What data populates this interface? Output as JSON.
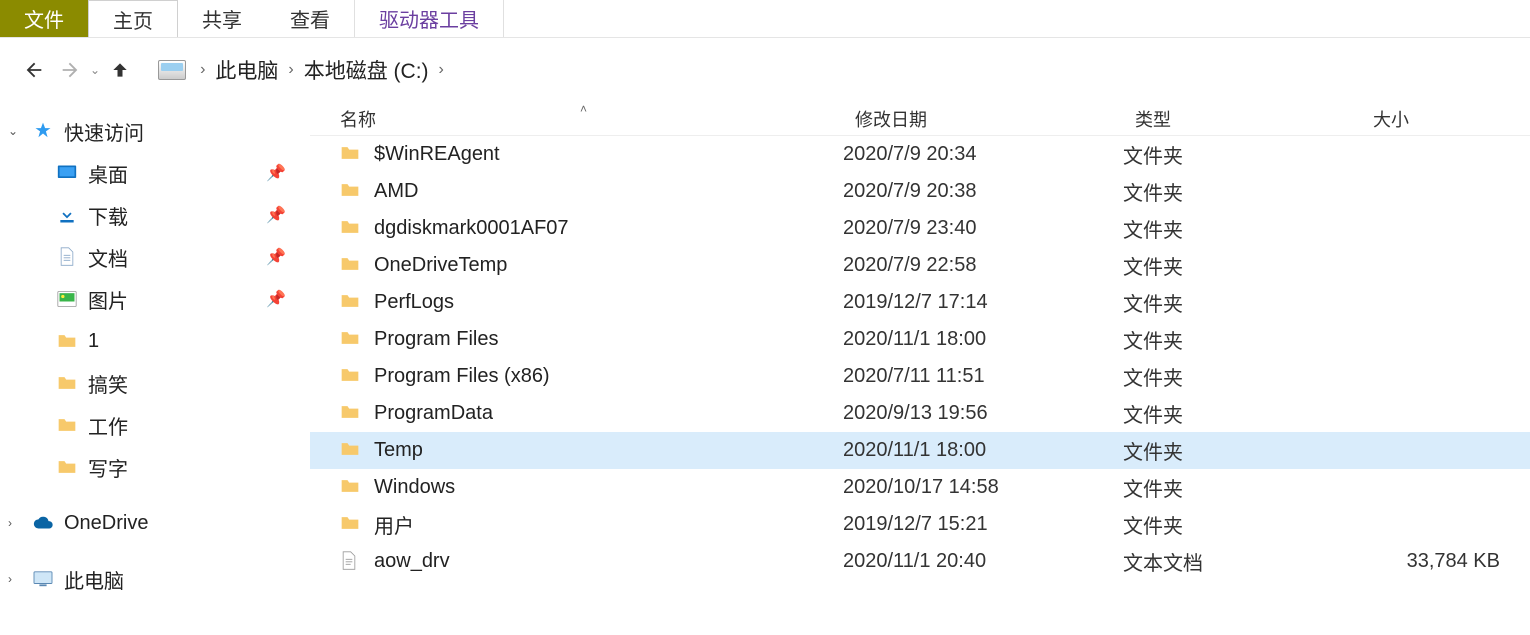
{
  "ribbon": {
    "tabs": {
      "file": "文件",
      "home": "主页",
      "share": "共享",
      "view": "查看",
      "drive_tools": "驱动器工具"
    }
  },
  "breadcrumb": {
    "items": [
      "此电脑",
      "本地磁盘 (C:)"
    ]
  },
  "sidebar": {
    "quick_access": "快速访问",
    "desktop": "桌面",
    "downloads": "下载",
    "documents": "文档",
    "pictures": "图片",
    "folder_1": "1",
    "folder_funny": "搞笑",
    "folder_work": "工作",
    "folder_write": "写字",
    "onedrive": "OneDrive",
    "this_pc": "此电脑"
  },
  "columns": {
    "name": "名称",
    "date": "修改日期",
    "type": "类型",
    "size": "大小"
  },
  "type_labels": {
    "folder": "文件夹",
    "txt": "文本文档"
  },
  "files": [
    {
      "name": "$WinREAgent",
      "date": "2020/7/9 20:34",
      "type": "folder",
      "size": ""
    },
    {
      "name": "AMD",
      "date": "2020/7/9 20:38",
      "type": "folder",
      "size": ""
    },
    {
      "name": "dgdiskmark0001AF07",
      "date": "2020/7/9 23:40",
      "type": "folder",
      "size": ""
    },
    {
      "name": "OneDriveTemp",
      "date": "2020/7/9 22:58",
      "type": "folder",
      "size": ""
    },
    {
      "name": "PerfLogs",
      "date": "2019/12/7 17:14",
      "type": "folder",
      "size": ""
    },
    {
      "name": "Program Files",
      "date": "2020/11/1 18:00",
      "type": "folder",
      "size": ""
    },
    {
      "name": "Program Files (x86)",
      "date": "2020/7/11 11:51",
      "type": "folder",
      "size": ""
    },
    {
      "name": "ProgramData",
      "date": "2020/9/13 19:56",
      "type": "folder",
      "size": ""
    },
    {
      "name": "Temp",
      "date": "2020/11/1 18:00",
      "type": "folder",
      "size": "",
      "selected": true
    },
    {
      "name": "Windows",
      "date": "2020/10/17 14:58",
      "type": "folder",
      "size": ""
    },
    {
      "name": "用户",
      "date": "2019/12/7 15:21",
      "type": "folder",
      "size": ""
    },
    {
      "name": "aow_drv",
      "date": "2020/11/1 20:40",
      "type": "txt",
      "size": "33,784 KB"
    }
  ],
  "icons": {
    "folder_color": "#f7c96b",
    "txt_color": "#9a9a9a"
  }
}
